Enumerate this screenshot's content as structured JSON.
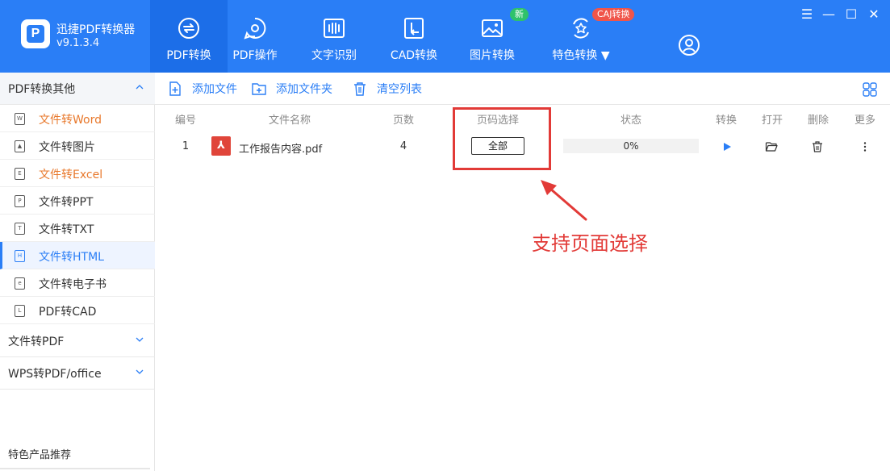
{
  "app": {
    "name": "迅捷PDF转换器",
    "version": "v9.1.3.4",
    "logo_letter": "P"
  },
  "nav": {
    "tabs": [
      {
        "label": "PDF转换",
        "icon": "pdf-convert-icon",
        "active": true
      },
      {
        "label": "PDF操作",
        "icon": "pdf-operate-icon"
      },
      {
        "label": "文字识别",
        "icon": "ocr-icon"
      },
      {
        "label": "CAD转换",
        "icon": "cad-convert-icon"
      },
      {
        "label": "图片转换",
        "icon": "image-convert-icon",
        "badge": "新"
      },
      {
        "label": "特色转换 ▼",
        "icon": "special-convert-icon",
        "badge": "CAJ转换"
      }
    ]
  },
  "window_controls": {
    "menu": "☰",
    "minimize": "—",
    "maximize": "☐",
    "close": "✕"
  },
  "sidebar": {
    "group1": "PDF转换其他",
    "items": [
      {
        "label": "文件转Word",
        "icon": "W"
      },
      {
        "label": "文件转图片",
        "icon": "▲"
      },
      {
        "label": "文件转Excel",
        "icon": "E"
      },
      {
        "label": "文件转PPT",
        "icon": "P"
      },
      {
        "label": "文件转TXT",
        "icon": "T"
      },
      {
        "label": "文件转HTML",
        "icon": "H"
      },
      {
        "label": "文件转电子书",
        "icon": "e"
      },
      {
        "label": "PDF转CAD",
        "icon": "L"
      }
    ],
    "group2": "文件转PDF",
    "group3": "WPS转PDF/office",
    "footer": "特色产品推荐"
  },
  "toolbar": {
    "add_file": "添加文件",
    "add_folder": "添加文件夹",
    "clear_list": "清空列表"
  },
  "table": {
    "headers": {
      "index": "编号",
      "name": "文件名称",
      "pages": "页数",
      "page_select": "页码选择",
      "status": "状态",
      "convert": "转换",
      "open": "打开",
      "delete": "删除",
      "more": "更多"
    },
    "rows": [
      {
        "index": "1",
        "name": "工作报告内容.pdf",
        "pages": "4",
        "page_select": "全部",
        "status": "0%",
        "progress": 0
      }
    ]
  },
  "annotation": {
    "text": "支持页面选择",
    "color": "#e23a37"
  },
  "colors": {
    "accent": "#2a7ef6",
    "orange": "#e8782b",
    "annotation": "#e23a37"
  }
}
